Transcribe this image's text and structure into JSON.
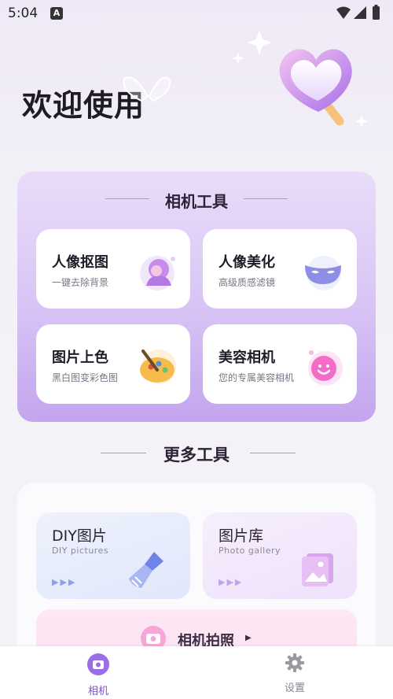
{
  "status_bar": {
    "time": "5:04",
    "notification_badge": "A"
  },
  "hero": {
    "title": "欢迎使用"
  },
  "camera_tools": {
    "heading": "相机工具",
    "items": [
      {
        "name": "人像抠图",
        "desc": "一键去除背景",
        "icon": "portrait-icon"
      },
      {
        "name": "人像美化",
        "desc": "高级质感滤镜",
        "icon": "mask-icon"
      },
      {
        "name": "图片上色",
        "desc": "黑白图变彩色图",
        "icon": "palette-icon"
      },
      {
        "name": "美容相机",
        "desc": "您的专属美容相机",
        "icon": "smiley-icon"
      }
    ]
  },
  "more_tools": {
    "heading": "更多工具",
    "items": [
      {
        "name": "DIY图片",
        "sub": "DIY pictures",
        "icon": "brush-icon"
      },
      {
        "name": "图片库",
        "sub": "Photo gallery",
        "icon": "gallery-icon"
      }
    ],
    "camera_shoot": "相机拍照"
  },
  "bottom_nav": [
    {
      "label": "相机",
      "active": true
    },
    {
      "label": "设置",
      "active": false
    }
  ],
  "colors": {
    "accent": "#9b6fe0",
    "active_tab": "#7d4fd3",
    "inactive_tab": "#8a8590"
  }
}
